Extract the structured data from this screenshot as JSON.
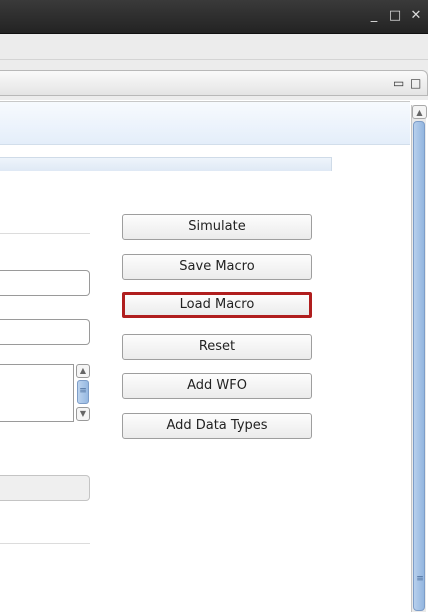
{
  "window_controls": {
    "minimize": "_",
    "maximize": "□",
    "close": "✕"
  },
  "view_controls": {
    "minimize": "▭",
    "maximize": "□"
  },
  "buttons": [
    {
      "label": "Simulate",
      "highlighted": false
    },
    {
      "label": "Save Macro",
      "highlighted": false
    },
    {
      "label": "Load Macro",
      "highlighted": true
    },
    {
      "label": "Reset",
      "highlighted": false
    },
    {
      "label": "Add WFO",
      "highlighted": false
    },
    {
      "label": "Add Data Types",
      "highlighted": false
    }
  ],
  "highlight_color": "#b01e1e",
  "scroll_glyphs": {
    "up": "▲",
    "down": "▼",
    "grip": "≡"
  }
}
